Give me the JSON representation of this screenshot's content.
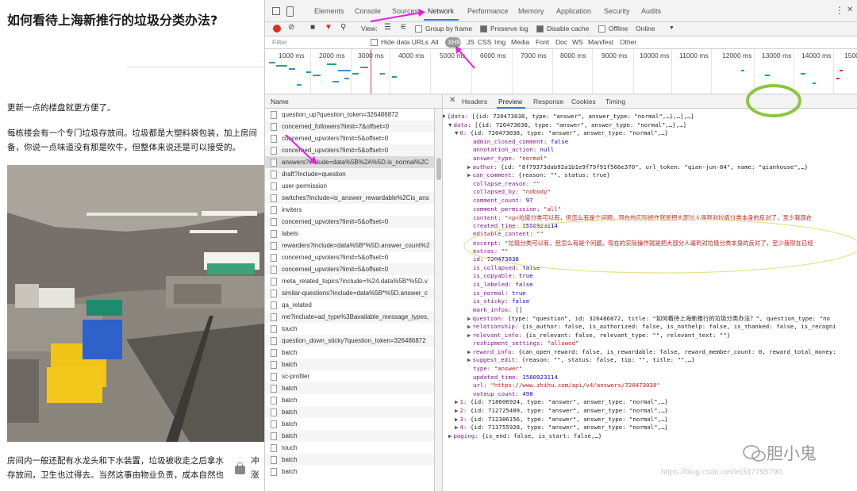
{
  "article": {
    "title": "如何看待上海新推行的垃圾分类办法?",
    "p1": "更新一点的楼盘就更方便了。",
    "p2": "每栋楼会有一个专门垃圾存放间。垃圾都是大塑料袋包装，加上房间",
    "p3": "备，你说一点味道没有那是吹牛，但整体来说还是可以接受的。",
    "p4": "房间内一般还配有水龙头和下水装置，垃圾被收走之后拿水",
    "p4b": "冲",
    "p5": "存放间，卫生也过得去。当然这事由物业负责，成本自然也",
    "p5b": "涨"
  },
  "devtools": {
    "tabs": [
      "Elements",
      "Console",
      "Sources",
      "Network",
      "Performance",
      "Memory",
      "Application",
      "Security",
      "Audits"
    ],
    "active_tab": "Network",
    "more_menu": "⋮",
    "close": "✕",
    "toolbar": {
      "view_label": "View:",
      "group_by_frame": "Group by frame",
      "preserve_log": "Preserve log",
      "disable_cache": "Disable cache",
      "offline": "Offline",
      "throttle": "Online",
      "preserve_log_checked": true,
      "disable_cache_checked": true
    },
    "filter": {
      "placeholder": "Filter",
      "hide_data_urls": "Hide data URLs",
      "types": [
        "All",
        "XHR",
        "JS",
        "CSS",
        "Img",
        "Media",
        "Font",
        "Doc",
        "WS",
        "Manifest",
        "Other"
      ],
      "active_type": "XHR"
    },
    "timeline_ticks": [
      "1000 ms",
      "2000 ms",
      "3000 ms",
      "4000 ms",
      "5000 ms",
      "6000 ms",
      "7000 ms",
      "8000 ms",
      "9000 ms",
      "10000 ms",
      "11000 ms",
      "12000 ms",
      "13000 ms",
      "14000 ms",
      "1500"
    ],
    "name_header": "Name",
    "requests": [
      "question_up?question_token=326486872",
      "concerned_followers?limit=7&offset=0",
      "concerned_upvoters?limit=5&offset=0",
      "concerned_upvoters?limit=5&offset=0",
      "answers?include=data%5B%2A%5D.is_normal%2C",
      "draft?include=question",
      "user-permission",
      "switches?include=is_answer_rewardable%2Cis_ans",
      "inviters",
      "concerned_upvoters?limit=5&offset=0",
      "labels",
      "rewarders?include=data%5B*%5D.answer_count%2",
      "concerned_upvoters?limit=5&offset=0",
      "concerned_upvoters?limit=5&offset=0",
      "meta_related_topics?include=%24.data%5B*%5D.v",
      "similar-questions?include=data%5B*%5D.answer_c",
      "qa_related",
      "me?include=ad_type%3Bavailable_message_types,",
      "touch",
      "question_down_sticky?question_token=326486872",
      "batch",
      "batch",
      "sc-profiler",
      "batch",
      "batch",
      "batch",
      "batch",
      "batch",
      "touch",
      "batch",
      "batch"
    ],
    "selected_request": 4,
    "detail_tabs": [
      "Headers",
      "Preview",
      "Response",
      "Cookies",
      "Timing"
    ],
    "active_detail_tab": "Preview",
    "preview_lines": [
      {
        "i": 0,
        "tri": "▼",
        "t": "{data: [{id: 720473038, type: \"answer\", answer_type: \"normal\",…},…],…}"
      },
      {
        "i": 1,
        "tri": "▼",
        "t": "data: [{id: 720473038, type: \"answer\", answer_type: \"normal\",…},…]"
      },
      {
        "i": 2,
        "tri": "▼",
        "t": "0: {id: 720473038, type: \"answer\", answer_type: \"normal\",…}"
      },
      {
        "i": 3,
        "tri": "",
        "t": "admin_closed_comment: false"
      },
      {
        "i": 3,
        "tri": "",
        "t": "annotation_action: null"
      },
      {
        "i": 3,
        "tri": "",
        "t": "answer_type: \"normal\""
      },
      {
        "i": 3,
        "tri": "▶",
        "t": "author: {id: \"8f79373dab92a1b1e9f79f91f566e370\", url_token: \"qian-jun-84\", name: \"qianhouse\",…}"
      },
      {
        "i": 3,
        "tri": "▶",
        "t": "can_comment: {reason: \"\", status: true}"
      },
      {
        "i": 3,
        "tri": "",
        "t": "collapse_reason: \"\""
      },
      {
        "i": 3,
        "tri": "",
        "t": "collapsed_by: \"nobody\""
      },
      {
        "i": 3,
        "tri": "",
        "t": "comment_count: 97"
      },
      {
        "i": 3,
        "tri": "",
        "t": "comment_permission: \"all\""
      },
      {
        "i": 3,
        "tri": "",
        "t": "content: \"<p>垃圾分类可以有，但怎么有是个问题，现在的实际操作就是把大部分人逼到对垃圾分类本身的反对了，至少我现在"
      },
      {
        "i": 3,
        "tri": "",
        "t": "created_time: 1560923114"
      },
      {
        "i": 3,
        "tri": "",
        "t": "editable_content: \"\""
      },
      {
        "i": 3,
        "tri": "",
        "t": "excerpt: \"垃圾分类可以有，但怎么有是个问题，现在的实际操作就是把大部分人逼到对垃圾分类本身的反对了，至少我现在已经"
      },
      {
        "i": 3,
        "tri": "",
        "t": "extras: \"\""
      },
      {
        "i": 3,
        "tri": "",
        "t": "id: 720473038"
      },
      {
        "i": 3,
        "tri": "",
        "t": "is_collapsed: false"
      },
      {
        "i": 3,
        "tri": "",
        "t": "is_copyable: true"
      },
      {
        "i": 3,
        "tri": "",
        "t": "is_labeled: false"
      },
      {
        "i": 3,
        "tri": "",
        "t": "is_normal: true"
      },
      {
        "i": 3,
        "tri": "",
        "t": "is_sticky: false"
      },
      {
        "i": 3,
        "tri": "",
        "t": "mark_infos: []"
      },
      {
        "i": 3,
        "tri": "▶",
        "t": "question: {type: \"question\", id: 326486872, title: \"如何看待上海新推行的垃圾分类办法？\", question_type: \"no"
      },
      {
        "i": 3,
        "tri": "▶",
        "t": "relationship: {is_author: false, is_authorized: false, is_nothelp: false, is_thanked: false, is_recogni"
      },
      {
        "i": 3,
        "tri": "▶",
        "t": "relevant_info: {is_relevant: false, relevant_type: \"\", relevant_text: \"\"}"
      },
      {
        "i": 3,
        "tri": "",
        "t": "reshipment_settings: \"allowed\""
      },
      {
        "i": 3,
        "tri": "▶",
        "t": "reward_info: {can_open_reward: false, is_rewardable: false, reward_member_count: 0, reward_total_money:"
      },
      {
        "i": 3,
        "tri": "▶",
        "t": "suggest_edit: {reason: \"\", status: false, tip: \"\", title: \"\",…}"
      },
      {
        "i": 3,
        "tri": "",
        "t": "type: \"answer\""
      },
      {
        "i": 3,
        "tri": "",
        "t": "updated_time: 1560923114"
      },
      {
        "i": 3,
        "tri": "",
        "t": "url: \"https://www.zhihu.com/api/v4/answers/720473038\""
      },
      {
        "i": 3,
        "tri": "",
        "t": "voteup_count: 498"
      },
      {
        "i": 2,
        "tri": "▶",
        "t": "1: {id: 718606924, type: \"answer\", answer_type: \"normal\",…}"
      },
      {
        "i": 2,
        "tri": "▶",
        "t": "2: {id: 712725409, type: \"answer\", answer_type: \"normal\",…}"
      },
      {
        "i": 2,
        "tri": "▶",
        "t": "3: {id: 712386156, type: \"answer\", answer_type: \"normal\",…}"
      },
      {
        "i": 2,
        "tri": "▶",
        "t": "4: {id: 713755928, type: \"answer\", answer_type: \"normal\",…}"
      },
      {
        "i": 1,
        "tri": "▶",
        "t": "paging: {is_end: false, is_start: false,…}"
      }
    ]
  },
  "watermark": "https://blog.csdn.net/lei347795790",
  "brand": "胆小鬼",
  "colors": {
    "highlight": "#8cc63f",
    "arrow": "#e41ee0",
    "record": "#d93025"
  }
}
